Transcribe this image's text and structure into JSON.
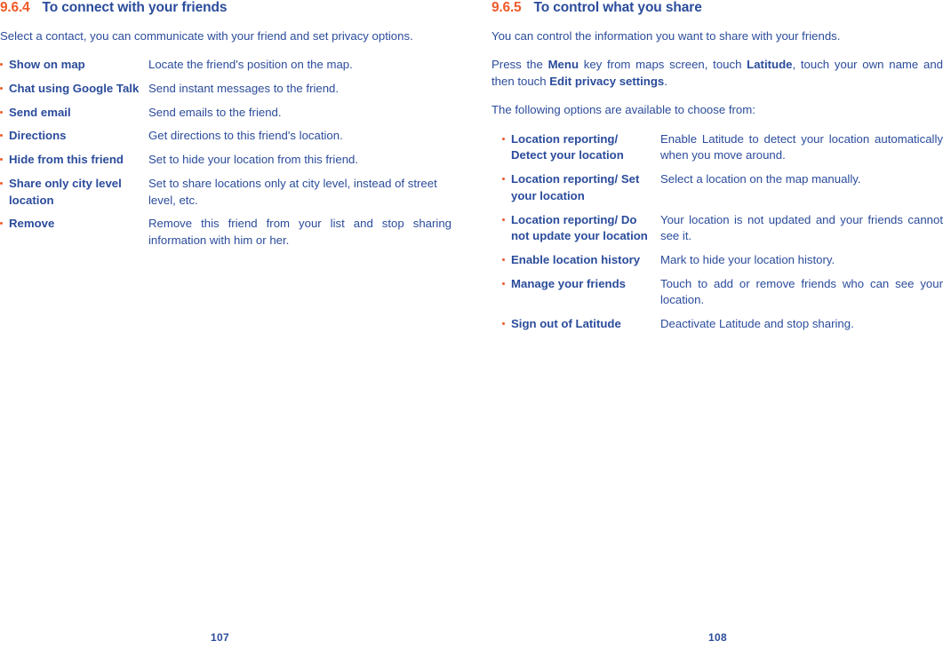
{
  "pages": [
    {
      "section_number": "9.6.4",
      "section_title": "To connect with your friends",
      "intro": "Select a contact, you can communicate with your friend and set privacy options.",
      "folio": "107",
      "items": [
        {
          "term": "Show on map",
          "desc": "Locate the friend's position on the map."
        },
        {
          "term": "Chat using Google Talk",
          "desc": "Send instant messages to the friend."
        },
        {
          "term": "Send email",
          "desc": "Send emails to the friend."
        },
        {
          "term": "Directions",
          "desc": "Get directions to this friend's location."
        },
        {
          "term": "Hide from this friend",
          "desc": "Set to hide your location from this friend."
        },
        {
          "term": "Share only city level location",
          "desc": "Set to share locations only at city level, instead of street level, etc."
        },
        {
          "term": "Remove",
          "desc": "Remove this friend from your list and stop sharing information with him or her."
        }
      ]
    },
    {
      "section_number": "9.6.5",
      "section_title": "To control what you share",
      "intro": "You can control the information you want to share with your friends.",
      "intro2_part1": "Press the ",
      "intro2_bold1": "Menu",
      "intro2_part2": " key from maps screen, touch ",
      "intro2_bold2": "Latitude",
      "intro2_part3": ", touch your own name and then touch ",
      "intro2_bold3": "Edit privacy settings",
      "intro2_part4": ".",
      "intro3": "The following options are available to choose from:",
      "folio": "108",
      "items": [
        {
          "term": "Location reporting/ Detect your location",
          "desc": "Enable Latitude to detect your location automatically when you move around."
        },
        {
          "term": "Location reporting/ Set your location",
          "desc": "Select a location on the map manually."
        },
        {
          "term": "Location reporting/ Do not update your location",
          "desc": "Your location is not updated and your friends cannot see it."
        },
        {
          "term": "Enable location history",
          "desc": "Mark to hide your location history."
        },
        {
          "term": "Manage your friends",
          "desc": "Touch to add or remove friends who can see your location."
        },
        {
          "term": "Sign out of Latitude",
          "desc": "Deactivate Latitude and stop sharing."
        }
      ]
    }
  ],
  "colors": {
    "accent_orange": "#ef5b29",
    "text_blue": "#2b4c9b"
  }
}
